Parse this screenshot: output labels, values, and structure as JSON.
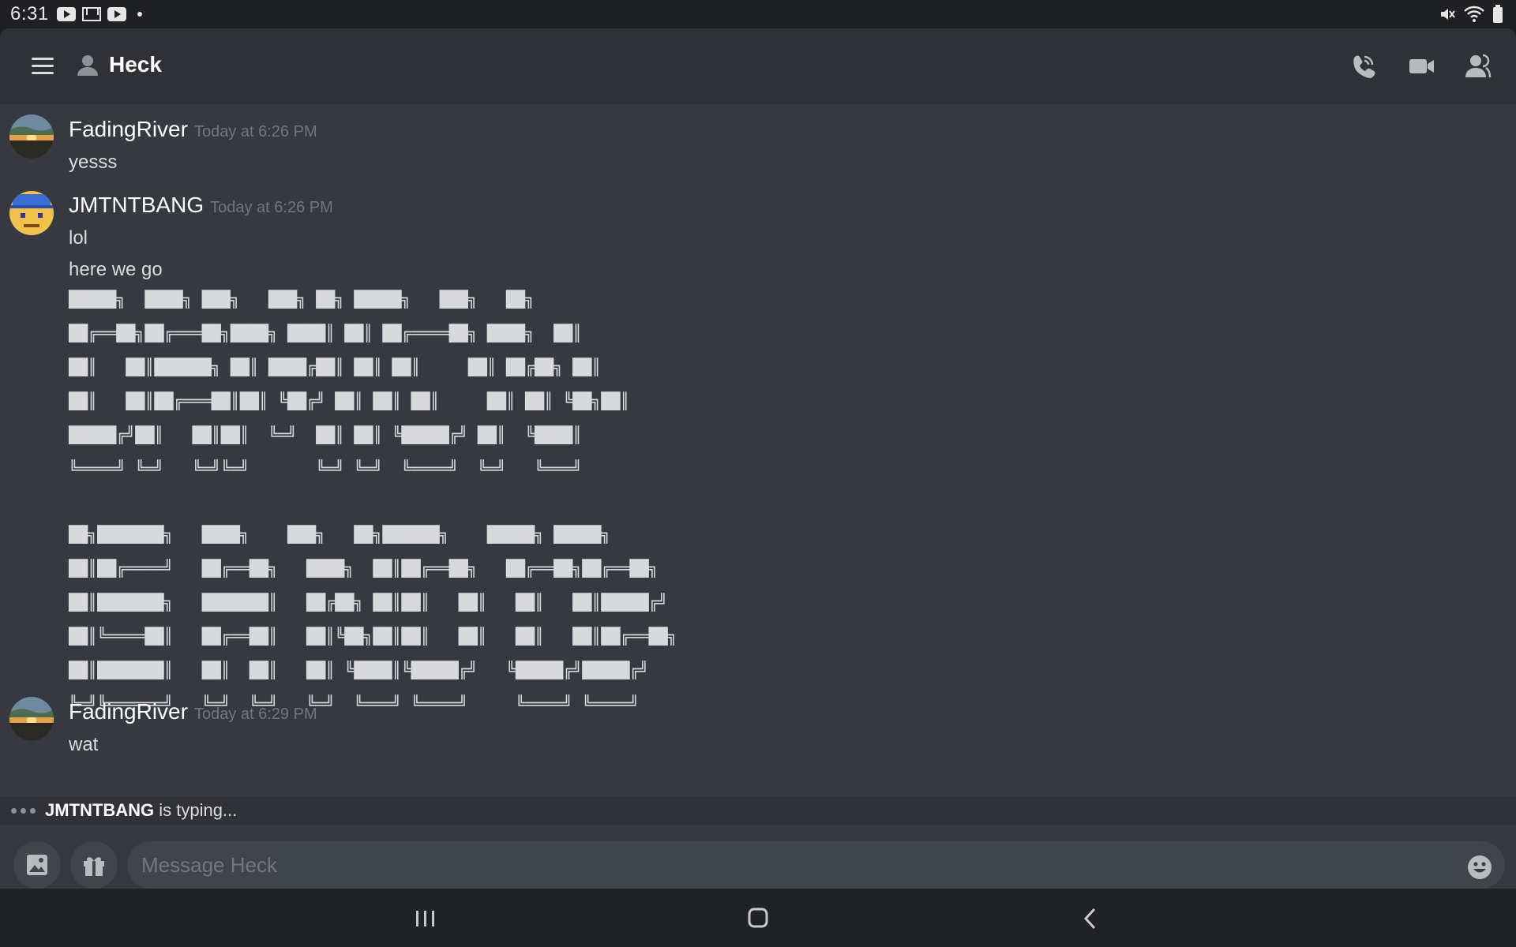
{
  "status_bar": {
    "time": "6:31",
    "icons": [
      "youtube-icon",
      "gmail-icon",
      "youtube-icon",
      "dot-icon",
      "mute-icon",
      "wifi-icon",
      "battery-icon"
    ]
  },
  "header": {
    "title": "Heck",
    "icons": [
      "menu-icon",
      "dm-user-icon",
      "call-icon",
      "video-icon",
      "members-icon"
    ]
  },
  "messages": [
    {
      "author": "FadingRiver",
      "timestamp": "Today at 6:26 PM",
      "lines": [
        "yesss"
      ]
    },
    {
      "author": "JMTNTBANG",
      "timestamp": "Today at 6:26 PM",
      "lines": [
        "lol",
        "here we go"
      ]
    },
    {
      "author": "FadingRiver",
      "timestamp": "Today at 6:29 PM",
      "lines": [
        "wat"
      ]
    }
  ],
  "ascii_art": {
    "block1": [
      "█████╗  ████╗ ███╗   ███╗ ██╗ █████╗   ███╗   ██╗",
      "██╔══██╗██╔═══██╗████╗ ████║ ██║ ██╔════██╗ ████╗  ██║",
      "██║   ██║██████╗ ██║ ████╔██║ ██║ ██║     ██║ ██╔██╗ ██║",
      "██║   ██║██╔═══██║██║ ╚██╔╝ ██║ ██║ ██║     ██║ ██║ ╚██╗██║",
      "█████╔╝██║   ██║██║  ╚═╝  ██║ ██║ ╚█████╔╝ ██║  ╚████║",
      "╚════╝ ╚═╝   ╚═╝╚═╝       ╚═╝ ╚═╝  ╚════╝  ╚═╝   ╚═══╝"
    ],
    "block2": [
      "██╗███████╗   ████╗    ███╗   ██╗██████╗    █████╗ █████╗",
      "██║██╔════╝   ██╔══██╗   ████╗  ██║██╔══██╗   ██╔══██╗██╔══██╗",
      "██║███████╗   ███████║   ██╔██╗ ██║██║   ██║   ██║   ██║█████╔╝",
      "██║╚════██║   ██╔══██║   ██║╚██╗██║██║   ██║   ██║   ██║██╔══██╗",
      "██║███████║   ██║  ██║   ██║ ╚████║╚█████╔╝   ╚█████╔╝█████╔╝",
      "╚═╝╚══════╝   ╚═╝  ╚═╝   ╚═╝  ╚═══╝ ╚════╝     ╚════╝ ╚════╝"
    ]
  },
  "typing": {
    "user": "JMTNTBANG",
    "suffix": " is typing..."
  },
  "composer": {
    "placeholder": "Message Heck",
    "buttons": [
      "image-icon",
      "gift-icon",
      "emoji-icon"
    ]
  },
  "nav_bar": {
    "buttons": [
      "recents-icon",
      "home-icon",
      "back-icon"
    ]
  }
}
